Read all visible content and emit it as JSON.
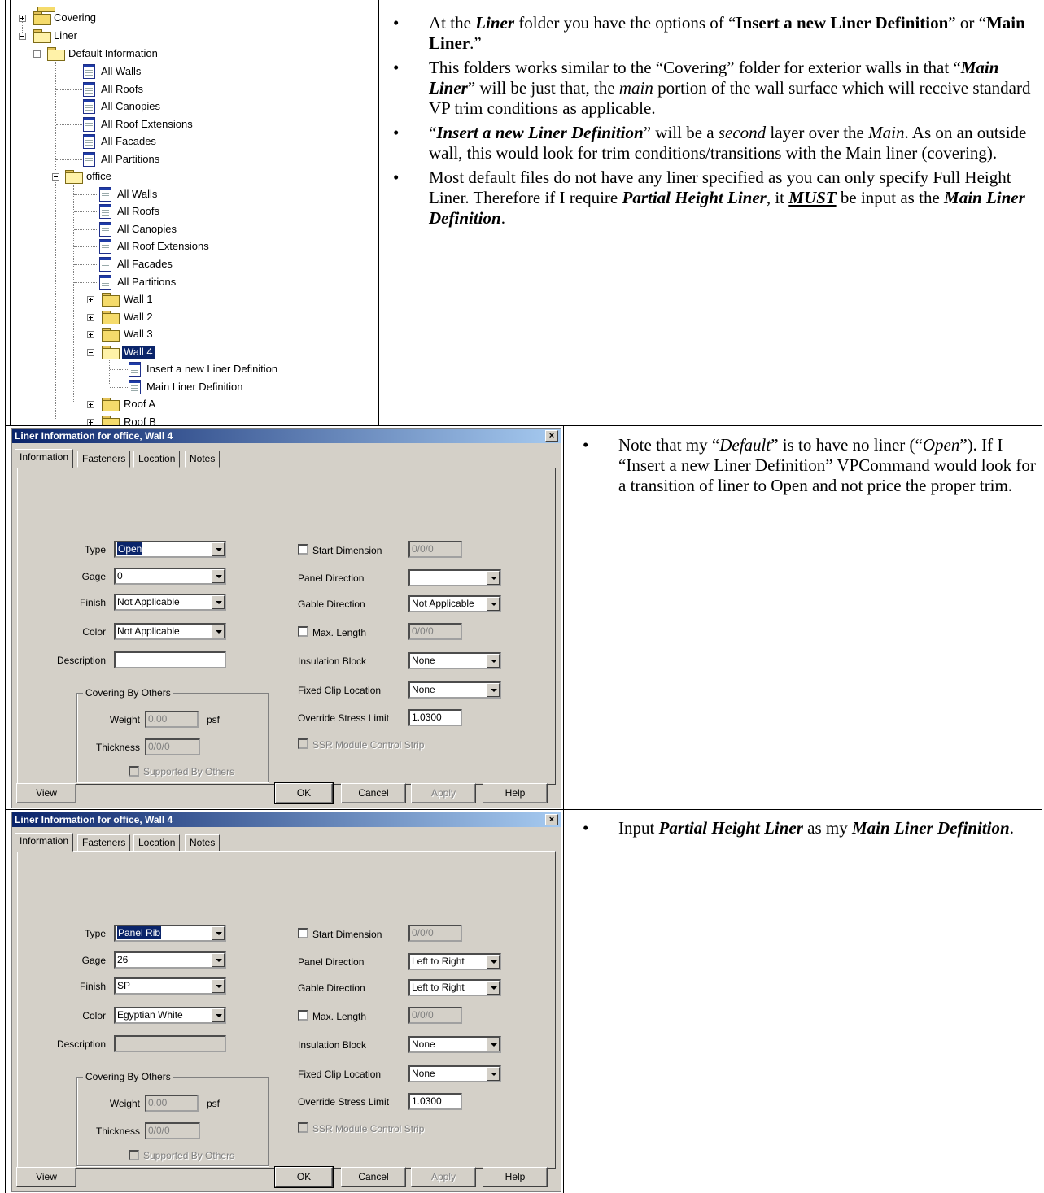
{
  "tree": {
    "items": [
      {
        "label": "Covering"
      },
      {
        "label": "Liner"
      },
      {
        "label": "Default Information"
      },
      {
        "label": "All Walls"
      },
      {
        "label": "All Roofs"
      },
      {
        "label": "All Canopies"
      },
      {
        "label": "All Roof Extensions"
      },
      {
        "label": "All Facades"
      },
      {
        "label": "All Partitions"
      },
      {
        "label": "office"
      },
      {
        "label": "All Walls"
      },
      {
        "label": "All Roofs"
      },
      {
        "label": "All Canopies"
      },
      {
        "label": "All Roof Extensions"
      },
      {
        "label": "All Facades"
      },
      {
        "label": "All Partitions"
      },
      {
        "label": "Wall 1"
      },
      {
        "label": "Wall 2"
      },
      {
        "label": "Wall 3"
      },
      {
        "label": "Wall 4"
      },
      {
        "label": "Insert a new Liner Definition"
      },
      {
        "label": "Main Liner Definition"
      },
      {
        "label": "Roof A"
      },
      {
        "label": "Roof B"
      }
    ]
  },
  "bullets_top": {
    "b1": {
      "t1": "At the ",
      "t2": "Liner",
      "t3": " folder you have the options of “",
      "t4": "Insert a new Liner Definition",
      "t5": "” or “",
      "t6": "Main Liner",
      "t7": ".”"
    },
    "b2": {
      "t1": "This folders works similar to the “Covering” folder for exterior walls in that “",
      "t2": "Main Liner",
      "t3": "” will be just that, the ",
      "t4": "main",
      "t5": " portion of the wall surface which will receive standard VP trim conditions as applicable."
    },
    "b3": {
      "t1": "“",
      "t2": "Insert a new Liner Definition",
      "t3": "” will be a ",
      "t4": "second",
      "t5": " layer over the ",
      "t6": "Main",
      "t7": ".  As on an outside wall, this would look for trim conditions/transitions with the Main liner (covering)."
    },
    "b4": {
      "t1": "Most default files do not have any liner specified as you can only specify Full Height Liner.  Therefore if I require ",
      "t2": "Partial Height Liner",
      "t3": ", it ",
      "t4": "MUST",
      "t5": " be input as the ",
      "t6": "Main Liner Definition",
      "t7": "."
    }
  },
  "bullets_mid": {
    "b1": {
      "t1": "Note that my “",
      "t2": "Default",
      "t3": "” is to have no liner (“",
      "t4": "Open",
      "t5": "”).  If I “Insert a new Liner Definition” VPCommand would look for a transition of liner to Open and not price the proper trim."
    }
  },
  "bullets_bot": {
    "b1": {
      "t1": "Input ",
      "t2": "Partial Height Liner",
      "t3": " as my ",
      "t4": "Main Liner Definition",
      "t5": "."
    }
  },
  "dialog1": {
    "title": "Liner Information for office, Wall 4",
    "close": "×",
    "tabs": [
      "Information",
      "Fasteners",
      "Location",
      "Notes"
    ],
    "labels": {
      "type": "Type",
      "gage": "Gage",
      "finish": "Finish",
      "color": "Color",
      "description": "Description",
      "covering_by_others": "Covering By Others",
      "weight": "Weight",
      "psf": "psf",
      "thickness": "Thickness",
      "supported": "Supported By Others",
      "start_dimension": "Start Dimension",
      "panel_direction": "Panel Direction",
      "gable_direction": "Gable Direction",
      "max_length": "Max. Length",
      "insulation_block": "Insulation Block",
      "fixed_clip": "Fixed Clip Location",
      "override_stress": "Override Stress Limit",
      "ssr": "SSR Module Control Strip"
    },
    "values": {
      "type": "Open",
      "gage": "0",
      "finish": "Not Applicable",
      "color": "Not Applicable",
      "description": "",
      "weight": "0.00",
      "thickness": "0/0/0",
      "start_dimension": "0/0/0",
      "panel_direction": "",
      "gable_direction": "Not Applicable",
      "max_length": "0/0/0",
      "insulation_block": "None",
      "fixed_clip": "None",
      "override_stress": "1.0300"
    },
    "buttons": {
      "view": "View",
      "ok": "OK",
      "cancel": "Cancel",
      "apply": "Apply",
      "help": "Help"
    }
  },
  "dialog2": {
    "title": "Liner Information for office, Wall 4",
    "close": "×",
    "tabs": [
      "Information",
      "Fasteners",
      "Location",
      "Notes"
    ],
    "labels": {
      "type": "Type",
      "gage": "Gage",
      "finish": "Finish",
      "color": "Color",
      "description": "Description",
      "covering_by_others": "Covering By Others",
      "weight": "Weight",
      "psf": "psf",
      "thickness": "Thickness",
      "supported": "Supported By Others",
      "start_dimension": "Start Dimension",
      "panel_direction": "Panel Direction",
      "gable_direction": "Gable Direction",
      "max_length": "Max. Length",
      "insulation_block": "Insulation Block",
      "fixed_clip": "Fixed Clip Location",
      "override_stress": "Override Stress Limit",
      "ssr": "SSR Module Control Strip"
    },
    "values": {
      "type": "Panel Rib",
      "gage": "26",
      "finish": "SP",
      "color": "Egyptian White",
      "description": "",
      "weight": "0.00",
      "thickness": "0/0/0",
      "start_dimension": "0/0/0",
      "panel_direction": "Left to Right",
      "gable_direction": "Left to Right",
      "max_length": "0/0/0",
      "insulation_block": "None",
      "fixed_clip": "None",
      "override_stress": "1.0300"
    },
    "buttons": {
      "view": "View",
      "ok": "OK",
      "cancel": "Cancel",
      "apply": "Apply",
      "help": "Help"
    }
  }
}
